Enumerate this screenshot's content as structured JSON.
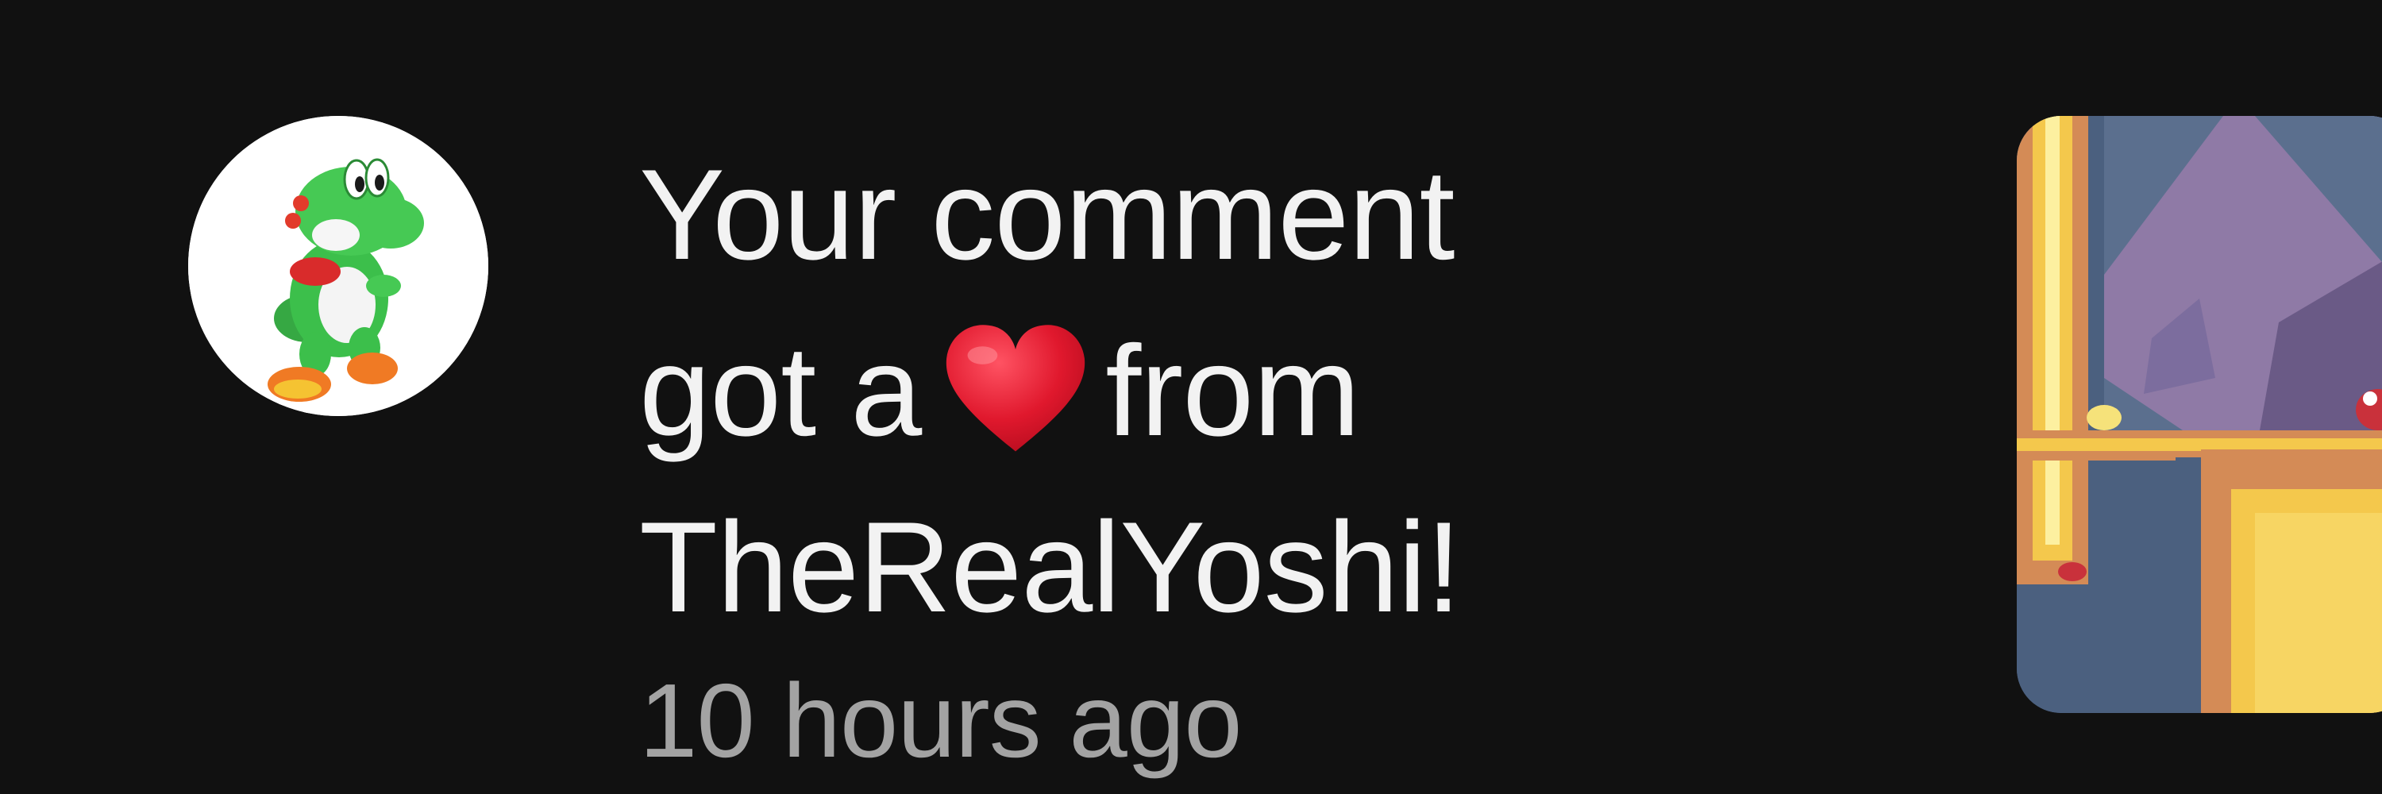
{
  "notification": {
    "message_line_1": "Your comment",
    "message_line_2_before": "got a",
    "message_line_2_after": "from",
    "message_line_3": "TheRealYoshi!",
    "timestamp": "10 hours ago",
    "heart_icon": "red-heart-emoji",
    "avatar_icon": "yoshi-avatar",
    "thumbnail_icon": "game-screenshot-thumbnail"
  },
  "colors": {
    "background": "#111111",
    "primary_text": "#f2f2f2",
    "secondary_text": "#a3a3a3",
    "heart": "#e0182d"
  }
}
